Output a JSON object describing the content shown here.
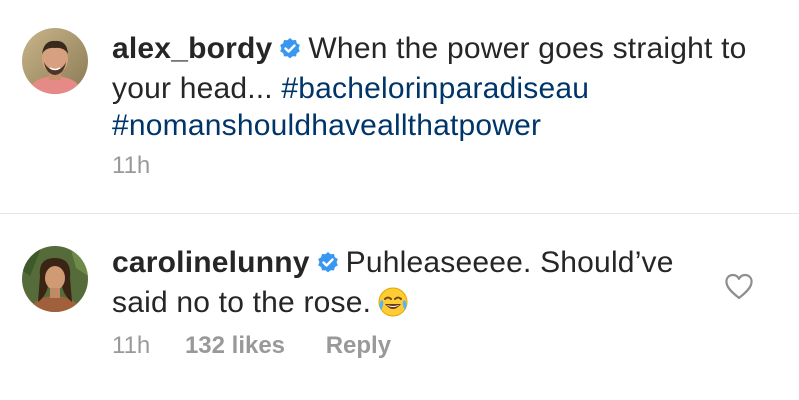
{
  "post": {
    "username": "alex_bordy",
    "caption_text": "When the power goes straight to your head...",
    "hashtags": [
      "#bachelorinparadiseau",
      "#nomanshouldhaveallthatpower"
    ],
    "time": "11h"
  },
  "comment": {
    "username": "carolinelunny",
    "text": "Puhleaseeee. Should’ve said no to the rose.",
    "time": "11h",
    "likes": "132 likes",
    "reply_label": "Reply"
  },
  "colors": {
    "hashtag": "#003569",
    "verified": "#3897f0",
    "meta": "#999999",
    "text": "#262626",
    "divider": "#e6e6e6"
  },
  "icons": {
    "verified": "verified-badge-icon",
    "heart": "heart-outline-icon",
    "emoji": "face-with-tears-of-joy-emoji"
  }
}
